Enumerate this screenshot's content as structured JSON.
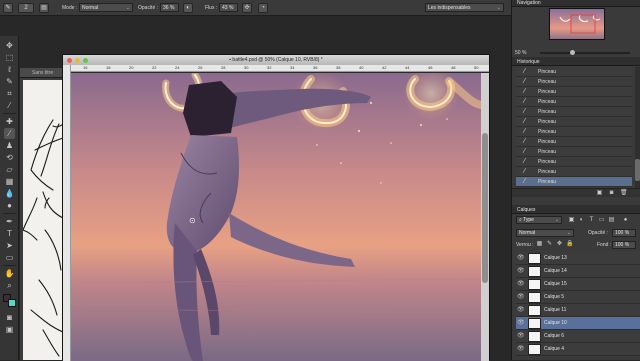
{
  "options_bar": {
    "mode_label": "Mode :",
    "mode_value": "Normal",
    "opacity_label": "Opacité :",
    "opacity_value": "36 %",
    "flow_label": "Flux :",
    "flow_value": "43 %",
    "workspace_value": "Les indispensables",
    "brush_size": "2"
  },
  "back_document": {
    "tab_title": "Sans titre"
  },
  "document": {
    "title": "battle4.psd @ 50% (Calque 10, RVB/8) *",
    "ruler_ticks": [
      "16",
      "18",
      "20",
      "22",
      "24",
      "26",
      "28",
      "30",
      "32",
      "34",
      "36",
      "38",
      "40",
      "42",
      "44",
      "46",
      "48",
      "50"
    ]
  },
  "navigator": {
    "title": "Navigation",
    "zoom": "50 %"
  },
  "history": {
    "title": "Historique",
    "items": [
      "Pinceau",
      "Pinceau",
      "Pinceau",
      "Pinceau",
      "Pinceau",
      "Pinceau",
      "Pinceau",
      "Pinceau",
      "Pinceau",
      "Pinceau",
      "Pinceau",
      "Pinceau"
    ],
    "selected_index": 11
  },
  "layers": {
    "title": "Calques",
    "filter_value": "Type",
    "blend_mode": "Normal",
    "opacity_label": "Opacité :",
    "opacity_value": "100 %",
    "lock_label": "Verrou :",
    "fill_label": "Fond :",
    "fill_value": "100 %",
    "items": [
      "Calque 13",
      "Calque 14",
      "Calque 15",
      "Calque 5",
      "Calque 11",
      "Calque 10",
      "Calque 6",
      "Calque 4"
    ],
    "selected_index": 5
  },
  "colors": {
    "accent_selection": "#59719a",
    "foreground": "#3d2b3a",
    "background": "#57d6c6"
  },
  "icons": {
    "toolbar": [
      "move-icon",
      "marquee-icon",
      "lasso-icon",
      "quick-select-icon",
      "crop-icon",
      "eyedropper-icon",
      "healing-icon",
      "brush-icon",
      "stamp-icon",
      "history-brush-icon",
      "eraser-icon",
      "gradient-icon",
      "blur-icon",
      "dodge-icon",
      "pen-icon",
      "type-icon",
      "path-select-icon",
      "shape-icon",
      "hand-icon",
      "zoom-icon"
    ]
  }
}
